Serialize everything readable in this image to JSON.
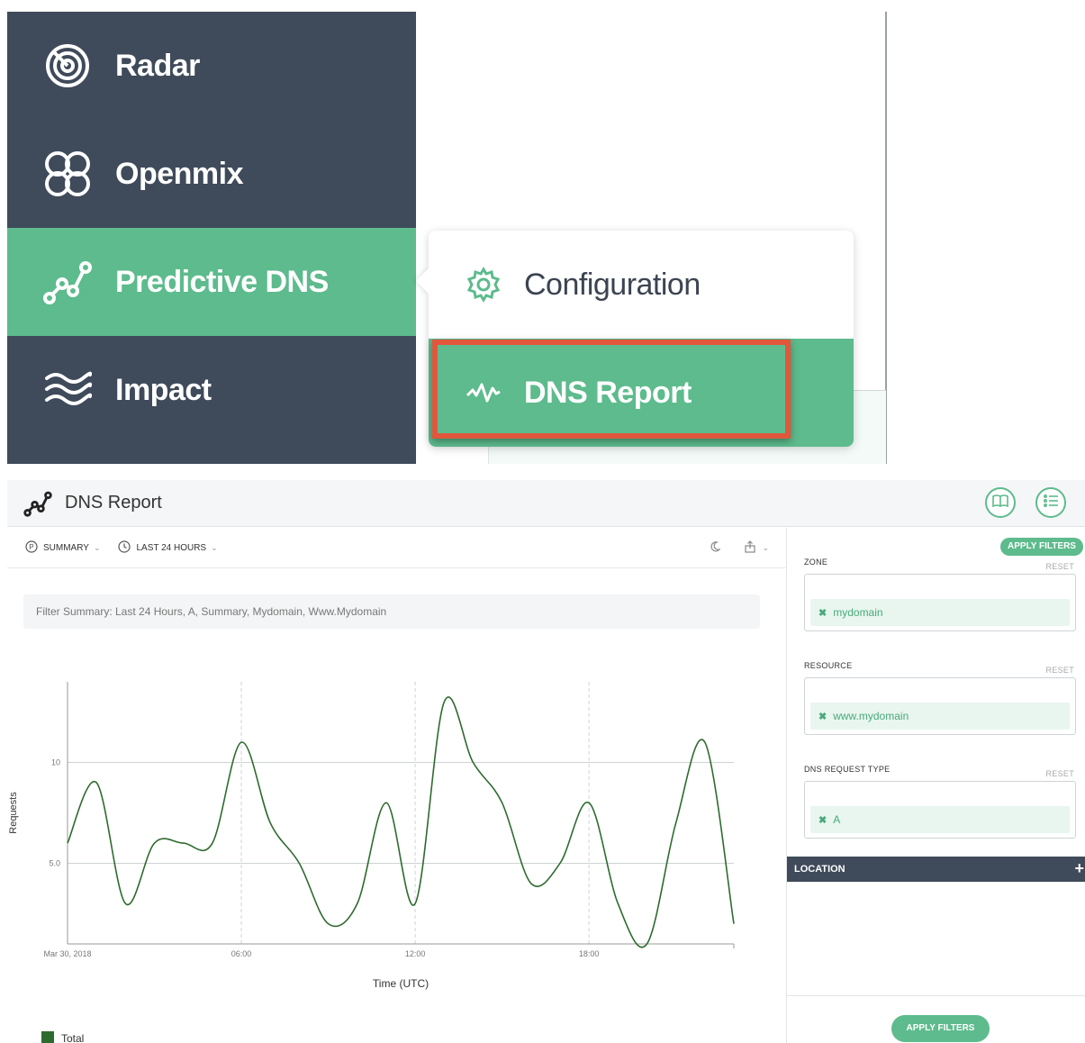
{
  "nav": {
    "items": [
      {
        "label": "Radar",
        "icon": "radar-icon"
      },
      {
        "label": "Openmix",
        "icon": "openmix-icon"
      },
      {
        "label": "Predictive DNS",
        "icon": "predictive-dns-icon",
        "active": true
      },
      {
        "label": "Impact",
        "icon": "impact-icon"
      }
    ],
    "flyout": [
      {
        "label": "Configuration",
        "icon": "gear-icon"
      },
      {
        "label": "DNS Report",
        "icon": "pulse-icon",
        "active": true
      }
    ]
  },
  "report": {
    "title": "DNS Report",
    "toolbar": {
      "summary_label": "SUMMARY",
      "range_label": "LAST 24 HOURS"
    },
    "filter_summary": "Filter Summary:  Last 24 Hours,  A,  Summary,  Mydomain,  Www.Mydomain"
  },
  "filters": {
    "apply_label": "APPLY FILTERS",
    "reset_label": "RESET",
    "zone": {
      "label": "ZONE",
      "chip": "mydomain"
    },
    "resource": {
      "label": "RESOURCE",
      "chip": "www.mydomain"
    },
    "dns_type": {
      "label": "DNS REQUEST TYPE",
      "chip": "A"
    },
    "location_label": "LOCATION",
    "location_plus": "+"
  },
  "colors": {
    "nav_bg": "#3f4a5a",
    "accent": "#5dbb8d",
    "highlight": "#e2573c",
    "series": "#2e6b2e"
  },
  "chart_data": {
    "type": "line",
    "xlabel": "Time (UTC)",
    "ylabel": "Requests",
    "ylim": [
      1.0,
      14.0
    ],
    "y_ticks": [
      "5.0",
      "10"
    ],
    "y_tick_values": [
      5,
      10
    ],
    "x_ticks": [
      "Mar 30, 2018",
      "06:00",
      "12:00",
      "18:00"
    ],
    "x_tick_values": [
      0,
      6,
      12,
      18
    ],
    "xlim": [
      0,
      23
    ],
    "legend": [
      "Total"
    ],
    "series": [
      {
        "name": "Total",
        "x": [
          0,
          1,
          2,
          3,
          4,
          5,
          6,
          7,
          8,
          9,
          10,
          11,
          12,
          13,
          14,
          15,
          16,
          17,
          18,
          19,
          20,
          21,
          22,
          23
        ],
        "values": [
          6,
          9,
          3,
          6,
          6,
          6,
          11,
          7,
          5,
          2,
          3,
          8,
          3,
          13,
          10,
          8,
          4,
          5,
          8,
          3,
          1,
          7,
          11,
          2
        ]
      }
    ]
  }
}
